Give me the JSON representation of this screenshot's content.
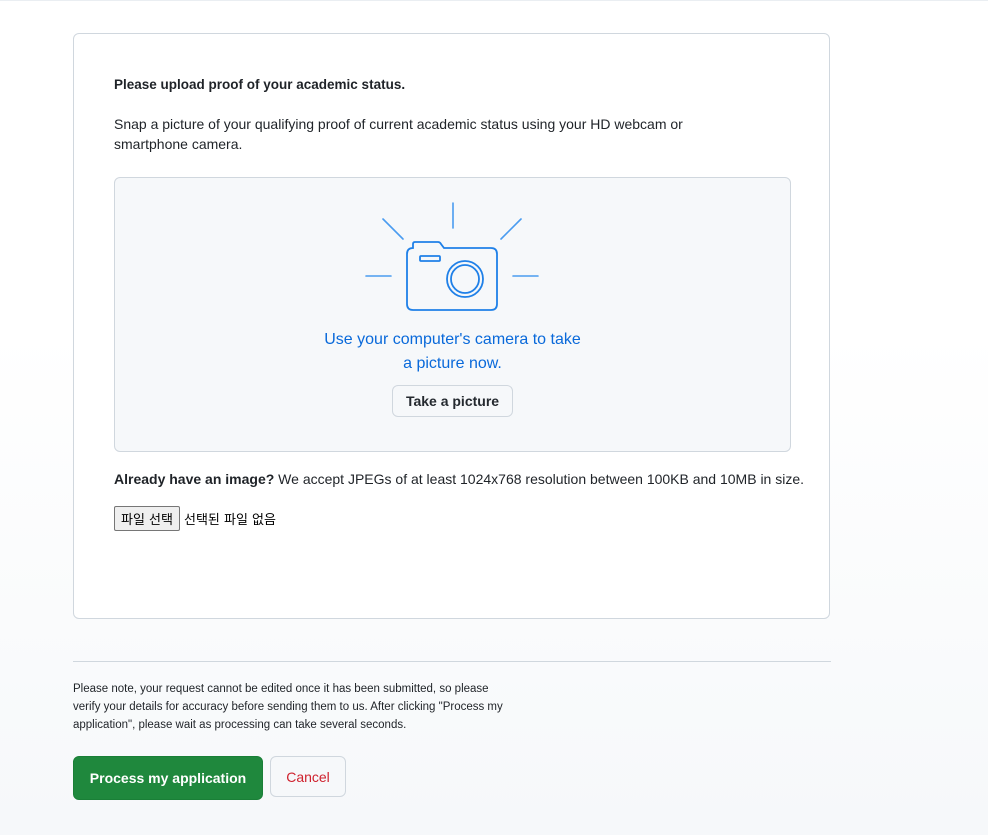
{
  "upload": {
    "heading": "Please upload proof of your academic status.",
    "description": "Snap a picture of your qualifying proof of current academic status using your HD webcam or smartphone camera.",
    "camera_prompt_line1": "Use your computer's camera to take",
    "camera_prompt_line2": "a picture now.",
    "take_picture_label": "Take a picture",
    "accept_bold": "Already have an image?",
    "accept_text": " We accept JPEGs of at least 1024x768 resolution between 100KB and 10MB in size.",
    "file_button_label": "파일 선택",
    "file_status": "선택된 파일 없음"
  },
  "footer": {
    "note": "Please note, your request cannot be edited once it has been submitted, so please verify your details for accuracy before sending them to us. After clicking \"Process my application\", please wait as processing can take several seconds.",
    "process_label": "Process my application",
    "cancel_label": "Cancel"
  },
  "icons": {
    "camera": "camera-icon"
  },
  "colors": {
    "accent_blue": "#0969da",
    "icon_blue": "#4a9cf0",
    "primary_green": "#1f883d",
    "danger_red": "#cf222e"
  }
}
